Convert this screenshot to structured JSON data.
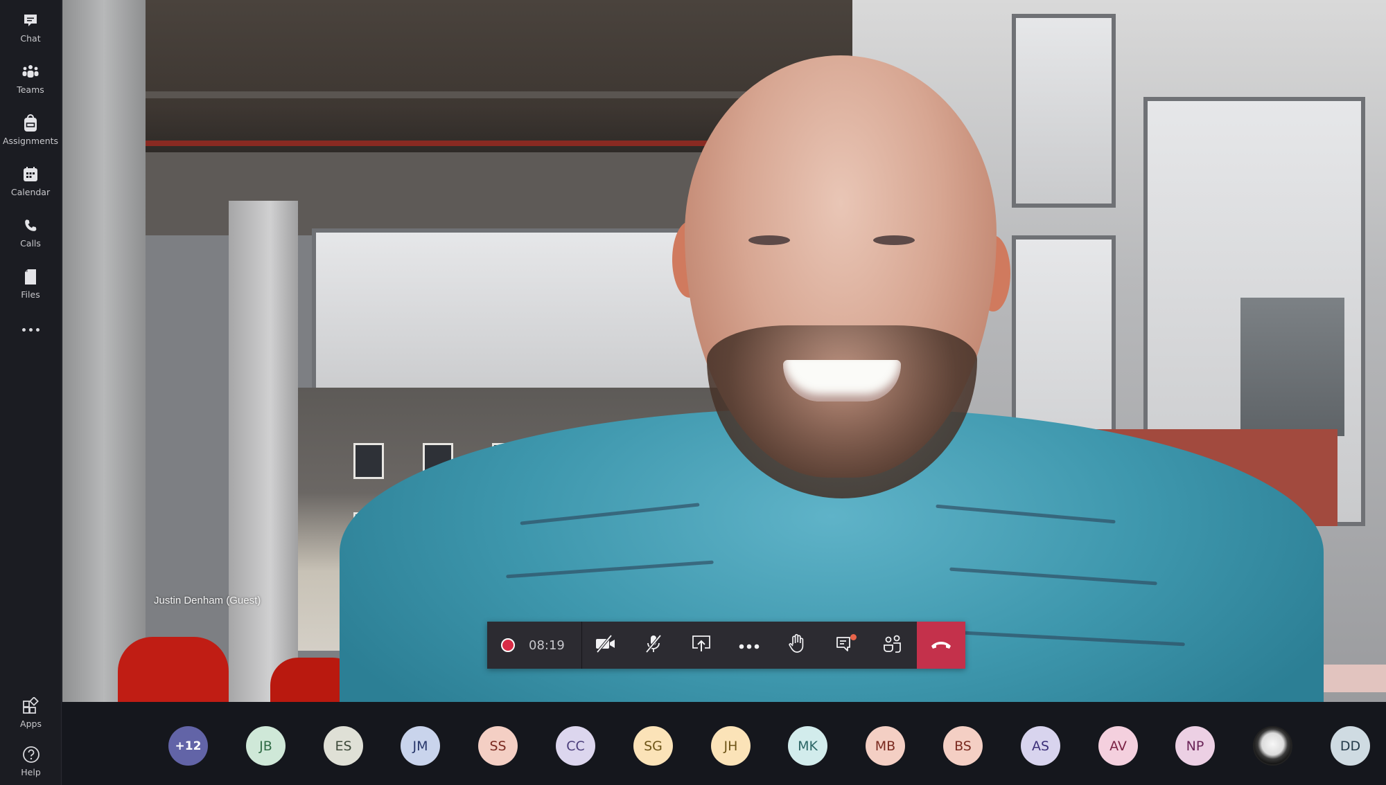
{
  "rail": {
    "top_items": [
      {
        "id": "chat",
        "label": "Chat",
        "icon": "chat-icon"
      },
      {
        "id": "teams",
        "label": "Teams",
        "icon": "teams-icon"
      },
      {
        "id": "assignments",
        "label": "Assignments",
        "icon": "backpack-icon"
      },
      {
        "id": "calendar",
        "label": "Calendar",
        "icon": "calendar-icon"
      },
      {
        "id": "calls",
        "label": "Calls",
        "icon": "phone-icon"
      },
      {
        "id": "files",
        "label": "Files",
        "icon": "file-icon"
      }
    ],
    "more_icon": "more-horizontal-icon",
    "bottom_items": [
      {
        "id": "apps",
        "label": "Apps",
        "icon": "apps-icon"
      },
      {
        "id": "help",
        "label": "Help",
        "icon": "help-icon"
      }
    ]
  },
  "video": {
    "speaker_name": "Justin Denham (Guest)"
  },
  "call_controls": {
    "recording_icon": "recording-icon",
    "elapsed_time": "08:19",
    "buttons": [
      {
        "id": "camera",
        "icon": "camera-off-icon",
        "state": "off"
      },
      {
        "id": "mic",
        "icon": "mic-off-icon",
        "state": "muted"
      },
      {
        "id": "share",
        "icon": "share-screen-icon"
      },
      {
        "id": "more",
        "icon": "more-actions-icon"
      },
      {
        "id": "raise-hand",
        "icon": "raise-hand-icon"
      },
      {
        "id": "chat",
        "icon": "meeting-chat-icon",
        "has_notification": true
      },
      {
        "id": "participants",
        "icon": "participants-icon"
      },
      {
        "id": "hang-up",
        "icon": "hang-up-icon"
      }
    ],
    "colors": {
      "recording": "#d92c46",
      "hang_up": "#c4314b",
      "notification": "#e9644a"
    }
  },
  "participants": {
    "overflow_label": "+12",
    "overflow_color": "#6264a7",
    "list": [
      {
        "initials": "JB",
        "bg": "#cfe8d8",
        "fg": "#2f6b45"
      },
      {
        "initials": "ES",
        "bg": "#dfe0d6",
        "fg": "#3d4a3a"
      },
      {
        "initials": "JM",
        "bg": "#c9d4ec",
        "fg": "#27366a"
      },
      {
        "initials": "SS",
        "bg": "#f4cfc4",
        "fg": "#7a2a20"
      },
      {
        "initials": "CC",
        "bg": "#dcd6ee",
        "fg": "#4a3d7a"
      },
      {
        "initials": "SG",
        "bg": "#fbe3b8",
        "fg": "#6e5518"
      },
      {
        "initials": "JH",
        "bg": "#fbe3b8",
        "fg": "#6e5518"
      },
      {
        "initials": "MK",
        "bg": "#d2ecec",
        "fg": "#2b6565"
      },
      {
        "initials": "MB",
        "bg": "#f4cfc4",
        "fg": "#7a2a20"
      },
      {
        "initials": "BS",
        "bg": "#f4cfc4",
        "fg": "#7a2a20"
      },
      {
        "initials": "AS",
        "bg": "#d8d4ee",
        "fg": "#3b2f78"
      },
      {
        "initials": "AV",
        "bg": "#f4d0de",
        "fg": "#7a2244"
      },
      {
        "initials": "NP",
        "bg": "#ecd0e4",
        "fg": "#6a2558"
      },
      {
        "initials": "",
        "photo": true
      },
      {
        "initials": "DD",
        "bg": "#cfdbe2",
        "fg": "#243b4a"
      }
    ]
  }
}
